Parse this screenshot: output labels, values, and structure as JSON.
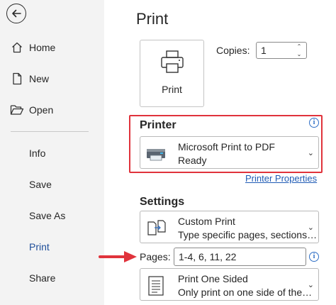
{
  "sidebar": {
    "items": [
      {
        "label": "Home",
        "icon": "home-icon"
      },
      {
        "label": "New",
        "icon": "new-document-icon"
      },
      {
        "label": "Open",
        "icon": "folder-open-icon"
      },
      {
        "label": "Info"
      },
      {
        "label": "Save"
      },
      {
        "label": "Save As"
      },
      {
        "label": "Print"
      },
      {
        "label": "Share"
      }
    ],
    "active": "Print"
  },
  "page": {
    "title": "Print"
  },
  "print_button": {
    "label": "Print"
  },
  "copies": {
    "label": "Copies:",
    "value": "1"
  },
  "printer": {
    "heading": "Printer",
    "name": "Microsoft Print to PDF",
    "status": "Ready",
    "properties_link": "Printer Properties"
  },
  "settings": {
    "heading": "Settings",
    "print_range": {
      "title": "Custom Print",
      "subtitle": "Type specific pages, sections…"
    },
    "pages": {
      "label": "Pages:",
      "value": "1-4, 6, 11, 22"
    },
    "sides": {
      "title": "Print One Sided",
      "subtitle": "Only print on one side of the…"
    }
  },
  "colors": {
    "highlight": "#e0333c",
    "link": "#1f5bb5",
    "active_nav": "#1f4e9a",
    "sidebar_bg": "#f3f3f3"
  }
}
